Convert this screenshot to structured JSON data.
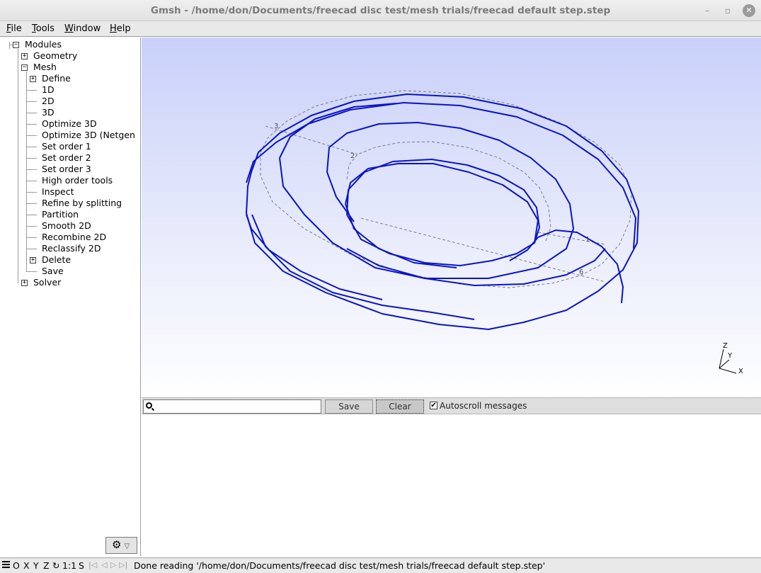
{
  "window": {
    "title": "Gmsh - /home/don/Documents/freecad disc test/mesh trials/freecad default step.step",
    "minimize_glyph": "–",
    "maximize_glyph": "▫",
    "close_glyph": "✕"
  },
  "menubar": {
    "items": [
      {
        "first": "F",
        "rest": "ile"
      },
      {
        "first": "T",
        "rest": "ools"
      },
      {
        "first": "W",
        "rest": "indow"
      },
      {
        "first": "H",
        "rest": "elp"
      }
    ]
  },
  "tree": {
    "modules": "Modules",
    "geometry": "Geometry",
    "mesh": "Mesh",
    "mesh_items": [
      "Define",
      "1D",
      "2D",
      "3D",
      "Optimize 3D",
      "Optimize 3D (Netgen",
      "Set order 1",
      "Set order 2",
      "Set order 3",
      "High order tools",
      "Inspect",
      "Refine by splitting",
      "Partition",
      "Smooth 2D",
      "Recombine 2D",
      "Reclassify 2D",
      "Delete",
      "Save"
    ],
    "solver": "Solver",
    "expand_glyph": "+",
    "collapse_glyph": "−"
  },
  "viewport": {
    "point_labels": [
      "3",
      "2",
      "1",
      "6"
    ],
    "axes": {
      "z": "Z",
      "y": "Y",
      "x": "X"
    },
    "colors": {
      "mesh_curve": "#0a14c8",
      "construction_line": "#707070"
    }
  },
  "messages": {
    "search_value": "",
    "save_label": "Save",
    "clear_label": "Clear",
    "autoscroll_label": "Autoscroll messages",
    "autoscroll_checked": true,
    "check_glyph": "✔"
  },
  "statusbar": {
    "view_buttons": [
      "O",
      "X",
      "Y",
      "Z"
    ],
    "rotate_glyph": "↻",
    "scale": "1:1",
    "s_button": "S",
    "nav": [
      "|◁",
      "◁",
      "▷",
      "▷|"
    ],
    "message": "Done reading '/home/don/Documents/freecad disc test/mesh trials/freecad default step.step'"
  },
  "gear": {
    "icon": "⚙",
    "arrow": "▽"
  }
}
